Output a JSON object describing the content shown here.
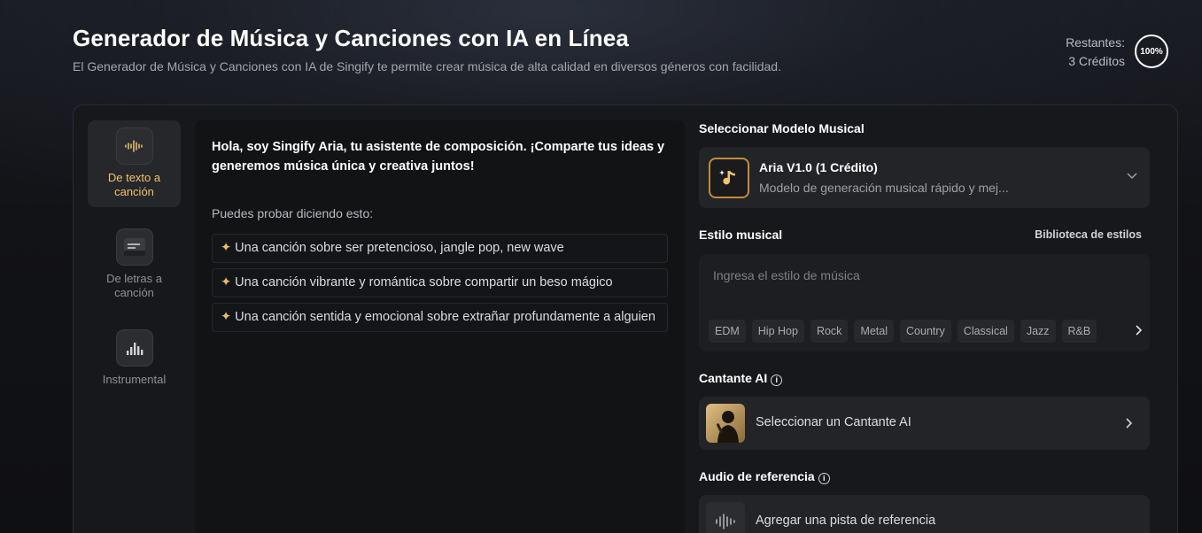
{
  "header": {
    "title": "Generador de Música y Canciones con IA en Línea",
    "subtitle": "El Generador de Música y Canciones con IA de Singify te permite crear música de alta calidad en diversos géneros con facilidad.",
    "credits_label": "Restantes:",
    "credits_value": "3 Créditos",
    "credits_percent": "100%"
  },
  "modes": [
    {
      "label": "De texto a canción",
      "icon": "waveform-icon",
      "active": true
    },
    {
      "label": "De letras a canción",
      "icon": "lyrics-icon",
      "active": false
    },
    {
      "label": "Instrumental",
      "icon": "equalizer-icon",
      "active": false
    }
  ],
  "chat": {
    "intro": "Hola, soy Singify Aria, tu asistente de composición. ¡Comparte tus ideas y generemos música única y creativa juntos!",
    "hint": "Puedes probar diciendo esto:",
    "suggestions": [
      "Una canción sobre ser pretencioso, jangle pop, new wave",
      "Una canción vibrante y romántica sobre compartir un beso mágico",
      "Una canción sentida y emocional sobre extrañar profundamente a alguien"
    ]
  },
  "model": {
    "section_label": "Seleccionar Modelo Musical",
    "name": "Aria V1.0 (1 Crédito)",
    "description": "Modelo de generación musical rápido y mej..."
  },
  "style": {
    "section_label": "Estilo musical",
    "library_link": "Biblioteca de estilos",
    "placeholder": "Ingresa el estilo de música",
    "chips": [
      "EDM",
      "Hip Hop",
      "Rock",
      "Metal",
      "Country",
      "Classical",
      "Jazz",
      "R&B"
    ]
  },
  "singer": {
    "section_label": "Cantante AI",
    "select_label": "Seleccionar un Cantante AI"
  },
  "reference": {
    "section_label": "Audio de referencia",
    "add_label": "Agregar una pista de referencia"
  },
  "colors": {
    "accent": "#f0c36b",
    "panel": "#17181b",
    "card": "#232428"
  }
}
